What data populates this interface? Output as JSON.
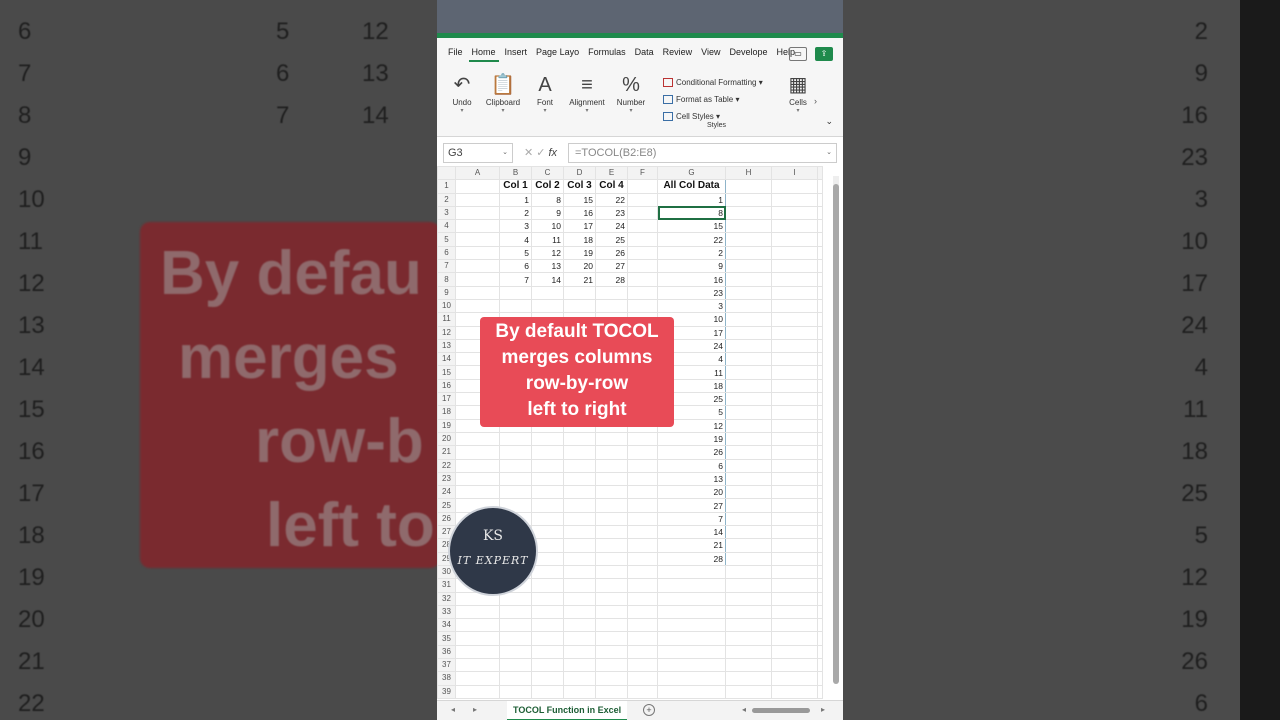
{
  "background": {
    "left_numbers": [
      "6",
      "7",
      "8",
      "9",
      "10",
      "11",
      "12",
      "13",
      "14",
      "15",
      "16",
      "17",
      "18",
      "19",
      "20",
      "21",
      "22"
    ],
    "left_values": [
      [
        "5",
        "12"
      ],
      [
        "6",
        "13"
      ],
      [
        "7",
        "14"
      ]
    ],
    "right_numbers": [
      "2",
      "9",
      "16",
      "23",
      "3",
      "10",
      "17",
      "24",
      "4",
      "11",
      "18",
      "25",
      "5",
      "12",
      "19",
      "26",
      "6"
    ],
    "left_text": [
      "By defau",
      "merges",
      "row-b",
      "left to"
    ]
  },
  "ribbon": {
    "tabs": [
      "File",
      "Home",
      "Insert",
      "Page Layo",
      "Formulas",
      "Data",
      "Review",
      "View",
      "Develope",
      "Help"
    ],
    "active_tab": "Home",
    "buttons": [
      {
        "label": "Undo",
        "icon": "↶"
      },
      {
        "label": "Clipboard",
        "icon": "📋"
      },
      {
        "label": "Font",
        "icon": "A"
      },
      {
        "label": "Alignment",
        "icon": "≡"
      },
      {
        "label": "Number",
        "icon": "%"
      }
    ],
    "styles": [
      "Conditional Formatting",
      "Format as Table",
      "Cell Styles"
    ],
    "styles_group": "Styles",
    "cells": "Cells"
  },
  "formula_bar": {
    "name_box": "G3",
    "formula": "=TOCOL(B2:E8)",
    "fx": "fx"
  },
  "sheet": {
    "columns": [
      "A",
      "B",
      "C",
      "D",
      "E",
      "F",
      "G",
      "H",
      "I"
    ],
    "headers": [
      "Col 1",
      "Col 2",
      "Col 3",
      "Col 4"
    ],
    "g_header": "All Col Data",
    "data": [
      [
        "1",
        "8",
        "15",
        "22"
      ],
      [
        "2",
        "9",
        "16",
        "23"
      ],
      [
        "3",
        "10",
        "17",
        "24"
      ],
      [
        "4",
        "11",
        "18",
        "25"
      ],
      [
        "5",
        "12",
        "19",
        "26"
      ],
      [
        "6",
        "13",
        "20",
        "27"
      ],
      [
        "7",
        "14",
        "21",
        "28"
      ]
    ],
    "tocol": [
      "1",
      "8",
      "15",
      "22",
      "2",
      "9",
      "16",
      "23",
      "3",
      "10",
      "17",
      "24",
      "4",
      "11",
      "18",
      "25",
      "5",
      "12",
      "19",
      "26",
      "6",
      "13",
      "20",
      "27",
      "7",
      "14",
      "21",
      "28"
    ],
    "row_count": 39
  },
  "callout": {
    "lines": [
      "By default TOCOL",
      "merges columns",
      "row-by-row",
      "left to right"
    ]
  },
  "logo": {
    "initials": "KS",
    "name": "IT EXPERT"
  },
  "sheet_tab": {
    "name": "TOCOL Function in Excel"
  }
}
